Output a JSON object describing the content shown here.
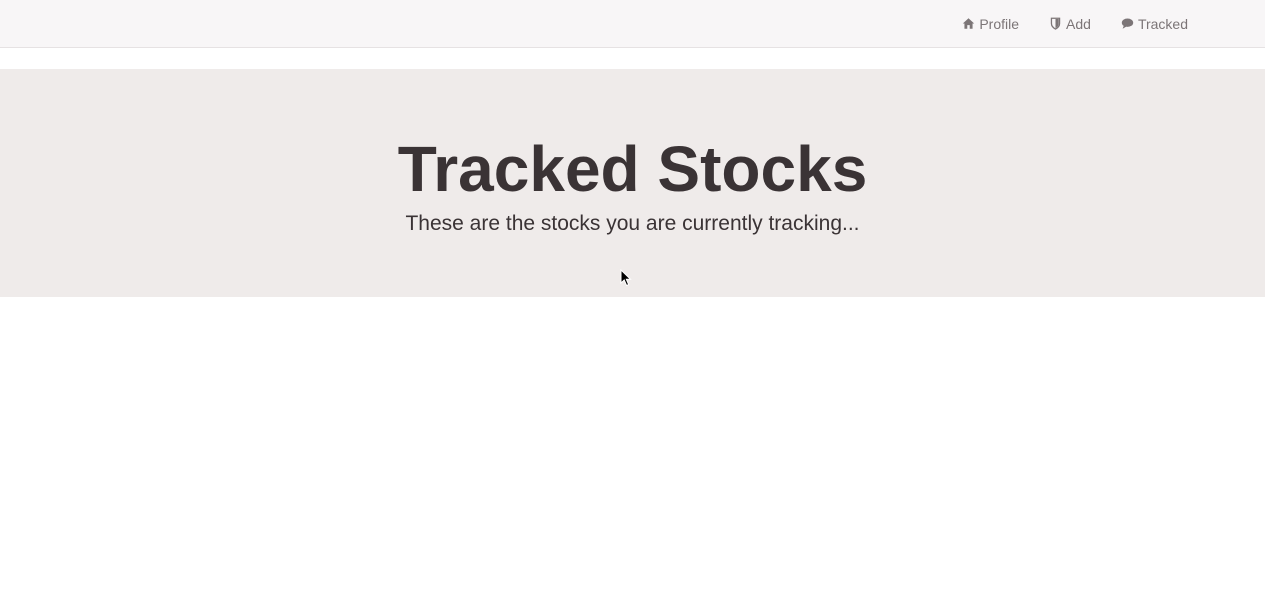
{
  "navbar": {
    "items": [
      {
        "label": "Profile",
        "icon": "home-icon"
      },
      {
        "label": "Add",
        "icon": "shield-icon"
      },
      {
        "label": "Tracked",
        "icon": "comment-icon"
      }
    ]
  },
  "jumbotron": {
    "title": "Tracked Stocks",
    "subtitle": "These are the stocks you are currently tracking..."
  },
  "colors": {
    "navbar_bg": "#f8f6f7",
    "jumbotron_bg": "#efebea",
    "nav_text": "#7c7577",
    "heading_text": "#3a3335"
  }
}
